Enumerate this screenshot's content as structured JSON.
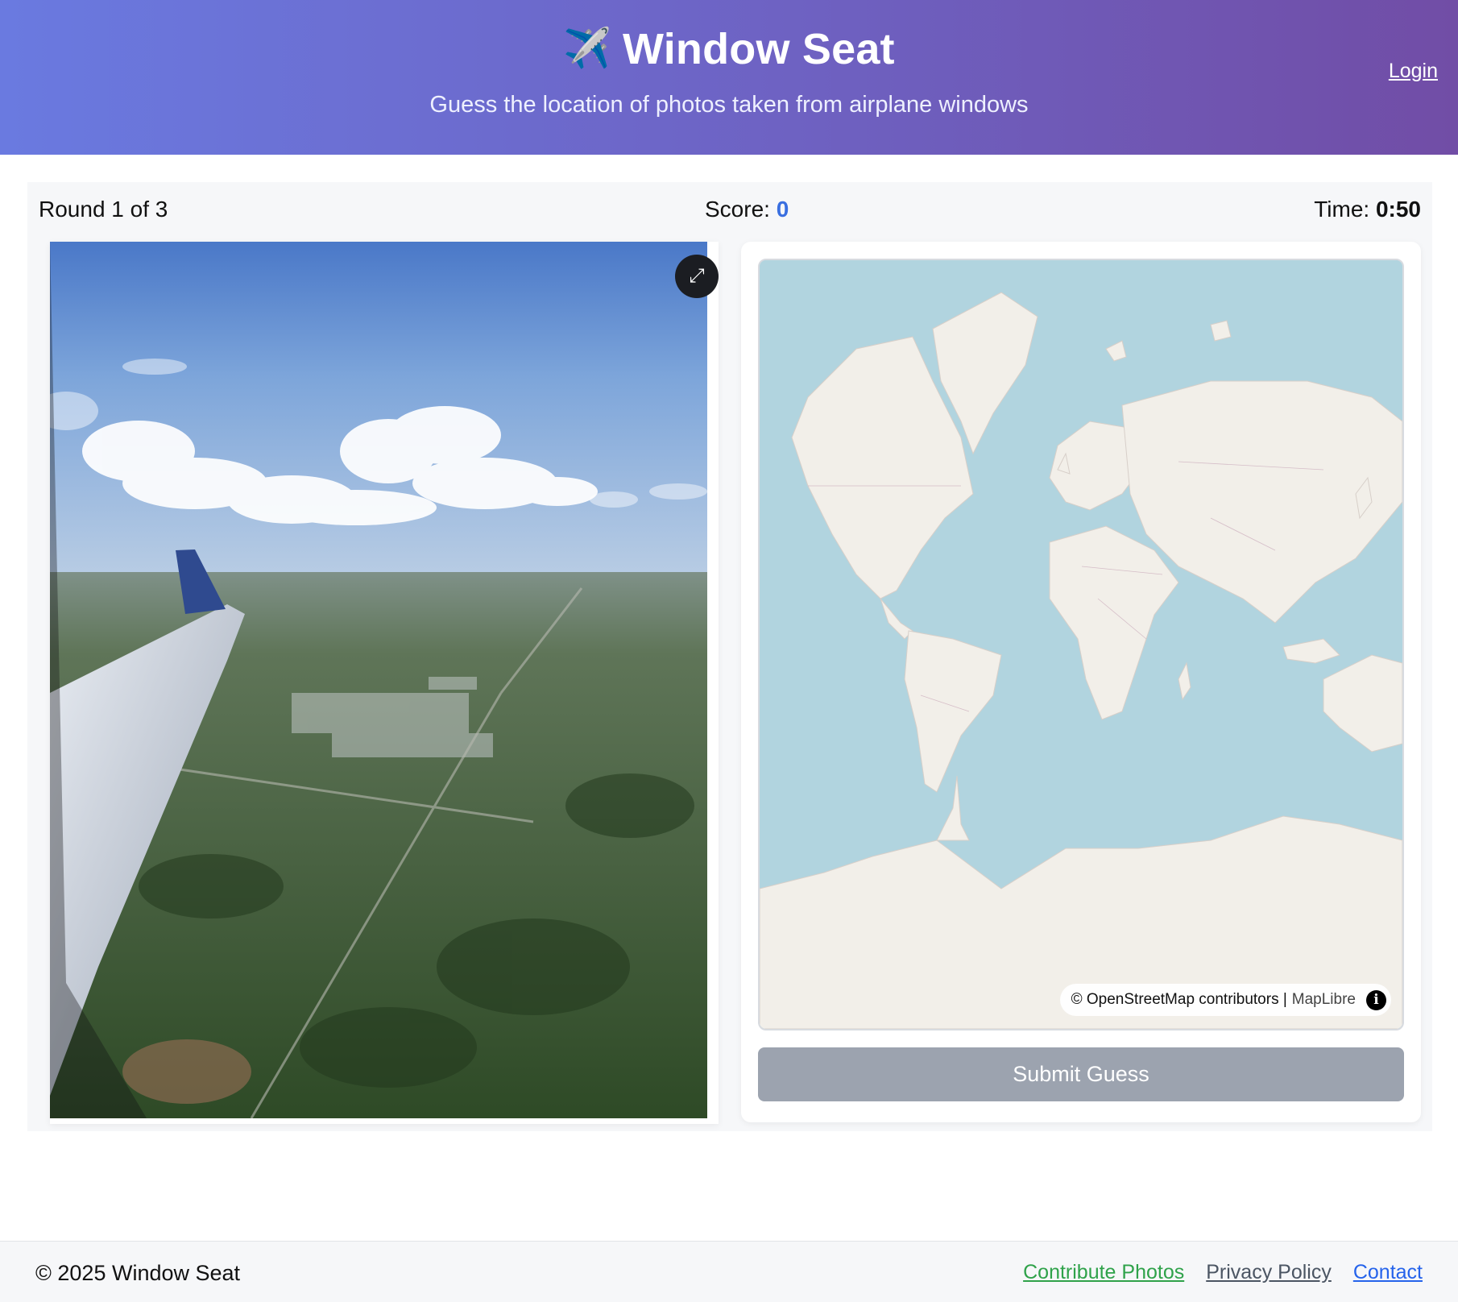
{
  "header": {
    "plane_icon": "✈️",
    "title": "Window Seat",
    "subtitle": "Guess the location of photos taken from airplane windows",
    "login_label": "Login"
  },
  "status": {
    "round_label": "Round 1 of 3",
    "score_label": "Score: ",
    "score_value": "0",
    "time_label": "Time: ",
    "time_value": "0:50"
  },
  "photo": {
    "description_icon": "expand-icon"
  },
  "map": {
    "attribution": "© OpenStreetMap contributors |",
    "attribution_lib": "MapLibre",
    "info_icon": "i"
  },
  "submit_label": "Submit Guess",
  "footer": {
    "copyright": "© 2025 Window Seat",
    "links": {
      "contribute": "Contribute Photos",
      "privacy": "Privacy Policy",
      "contact": "Contact"
    }
  },
  "colors": {
    "header_start": "#6a7ae0",
    "header_end": "#714da6",
    "score_accent": "#3a6fe0",
    "submit_disabled": "#9ca3af",
    "map_water": "#b1d4df",
    "map_land": "#f2efe9"
  }
}
